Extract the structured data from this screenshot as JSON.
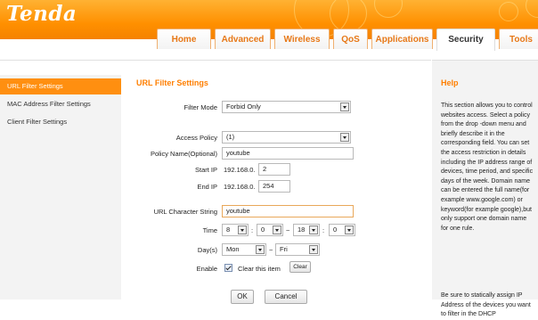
{
  "brand": {
    "logo_text": "Tenda"
  },
  "nav": {
    "tabs": [
      {
        "label": "Home"
      },
      {
        "label": "Advanced"
      },
      {
        "label": "Wireless"
      },
      {
        "label": "QoS"
      },
      {
        "label": "Applications"
      },
      {
        "label": "Security",
        "active": true
      },
      {
        "label": "Tools"
      }
    ]
  },
  "sidebar": {
    "items": [
      {
        "label": "URL Filter Settings",
        "active": true
      },
      {
        "label": "MAC Address Filter Settings"
      },
      {
        "label": "Client Filter Settings"
      }
    ]
  },
  "form": {
    "title": "URL Filter Settings",
    "filter_mode": {
      "label": "Filter Mode",
      "value": "Forbid Only"
    },
    "access_policy": {
      "label": "Access Policy",
      "value": "(1)"
    },
    "policy_name": {
      "label": "Policy Name(Optional)",
      "value": "youtube"
    },
    "start_ip": {
      "label": "Start IP",
      "prefix": "192.168.0.",
      "value": "2"
    },
    "end_ip": {
      "label": "End IP",
      "prefix": "192.168.0.",
      "value": "254"
    },
    "url_string": {
      "label": "URL Character String",
      "value": "youtube"
    },
    "time": {
      "label": "Time",
      "start_hour": "8",
      "start_min": "0",
      "end_hour": "18",
      "end_min": "0",
      "sep": ":",
      "range": "~"
    },
    "days": {
      "label": "Day(s)",
      "from": "Mon",
      "to": "Fri",
      "range": "~"
    },
    "enable": {
      "label": "Enable",
      "checked": true,
      "clear_text": "Clear this item",
      "clear_button": "Clear"
    },
    "ok_button": "OK",
    "cancel_button": "Cancel"
  },
  "help": {
    "title": "Help",
    "text": "This section allows you to control websites access. Select a policy from the drop -down menu and briefly describe it in the corresponding field. You can set the access restriction in details including the IP address range of devices, time period, and specific days of the week. Domain name can be entered the full name(for example www.google.com) or keyword(for example google),but only support one domain name for one rule.",
    "text2": "Be sure to statically assign IP Address of the devices you want to filter in the DHCP"
  },
  "colors": {
    "accent": "#ff8f10",
    "title": "#ff7f00",
    "tab_text": "#e77817"
  }
}
